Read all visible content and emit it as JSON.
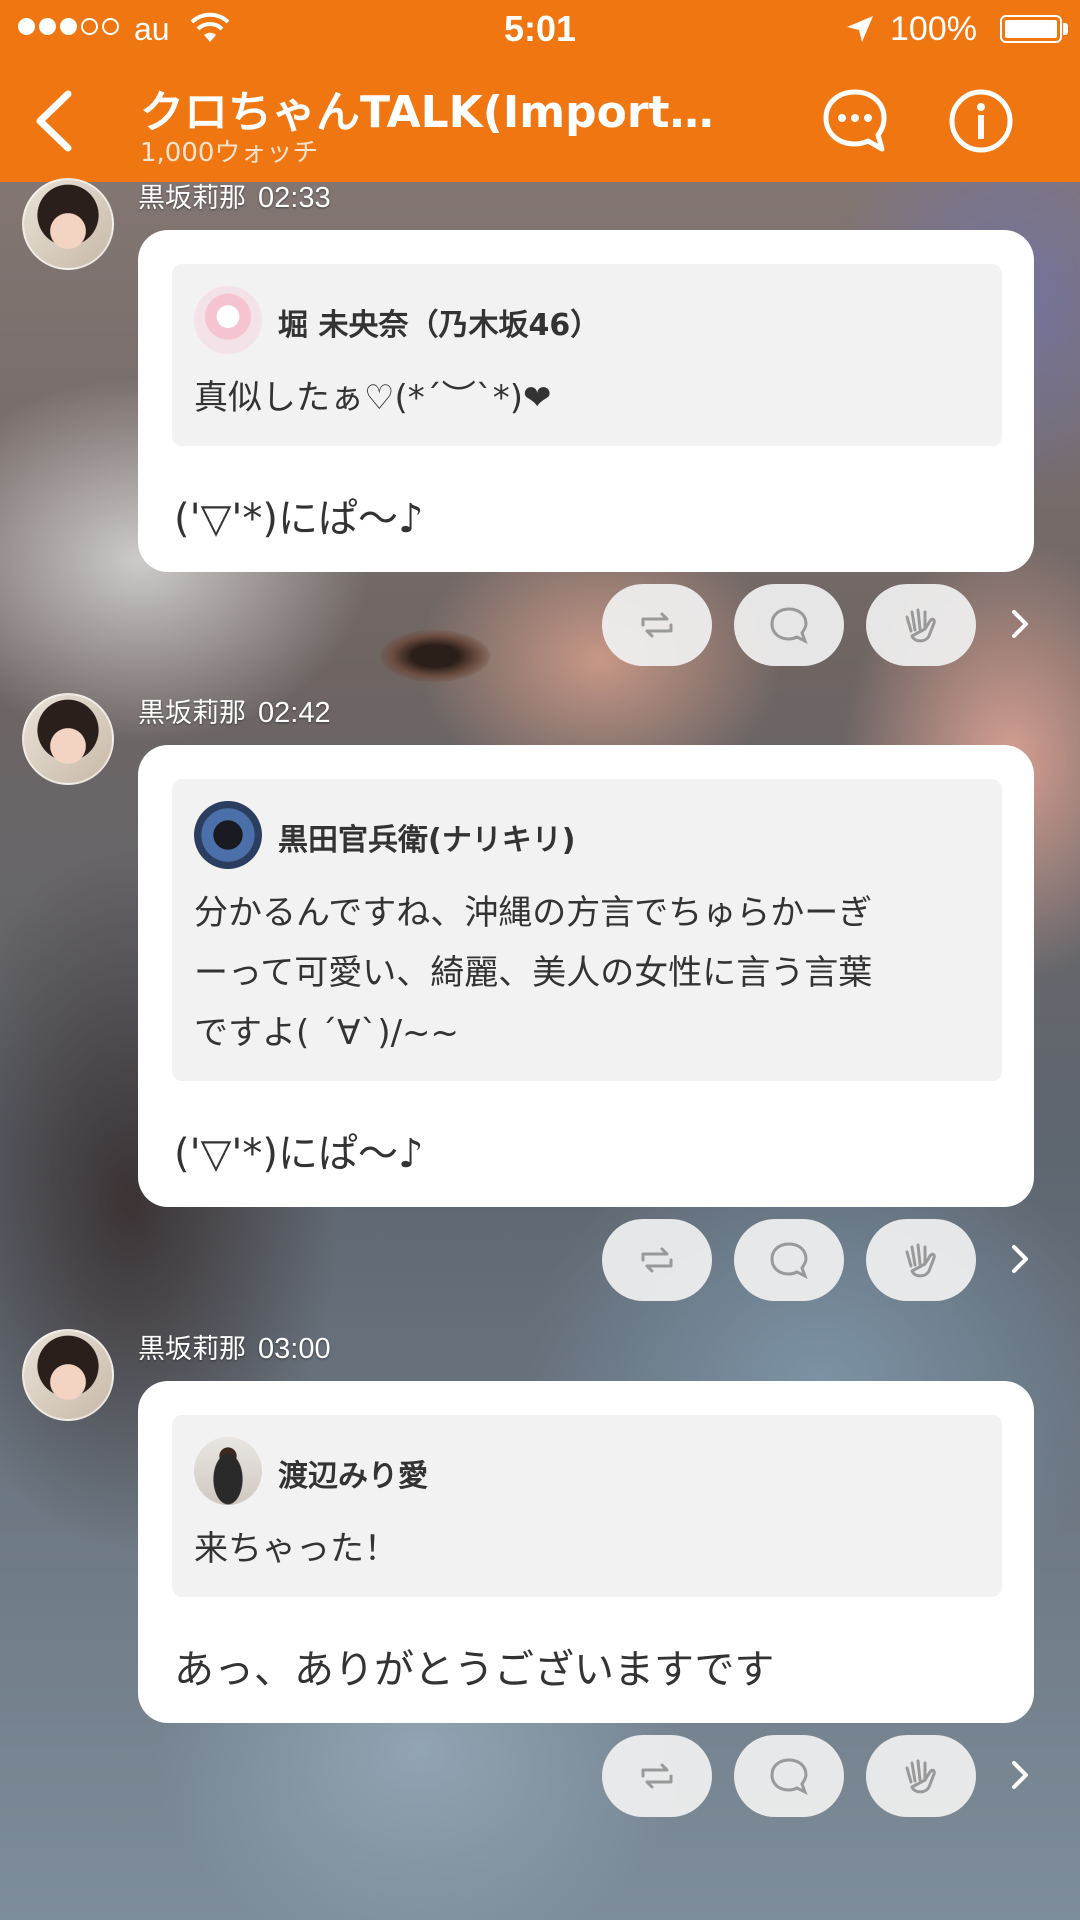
{
  "status_bar": {
    "carrier": "au",
    "time": "5:01",
    "battery": "100%"
  },
  "nav": {
    "title": "クロちゃんTALK(Importan...",
    "subtitle": "1,000ウォッチ"
  },
  "messages": [
    {
      "author": "黒坂莉那",
      "time": "02:33",
      "quote_author": "堀  未央奈（乃木坂46）",
      "quote_lines": [
        "真似したぁ♡(*´︶`*)❤"
      ],
      "reply": "('▽'*)にぱ〜♪"
    },
    {
      "author": "黒坂莉那",
      "time": "02:42",
      "quote_author": "黒田官兵衛(ナリキリ)",
      "quote_lines": [
        "分かるんですね、沖縄の方言でちゅらかーぎ",
        "ーって可愛い、綺麗、美人の女性に言う言葉",
        "ですよ( ´∀`)/~~"
      ],
      "reply": "('▽'*)にぱ〜♪"
    },
    {
      "author": "黒坂莉那",
      "time": "03:00",
      "quote_author": "渡辺みり愛",
      "quote_lines": [
        "来ちゃった！"
      ],
      "reply": "あっ、ありがとうございますです"
    }
  ],
  "icons": {
    "repost": "repost-icon",
    "comment": "comment-icon",
    "clap": "clap-icon",
    "more": "chevron-right-icon",
    "back": "back-arrow-icon",
    "chat": "chat-bubble-icon",
    "info": "info-icon"
  },
  "colors": {
    "accent": "#ef7610",
    "bubble": "#ffffff",
    "quote_bg": "#f2f2f2",
    "action_bg": "#f0f0f0"
  }
}
